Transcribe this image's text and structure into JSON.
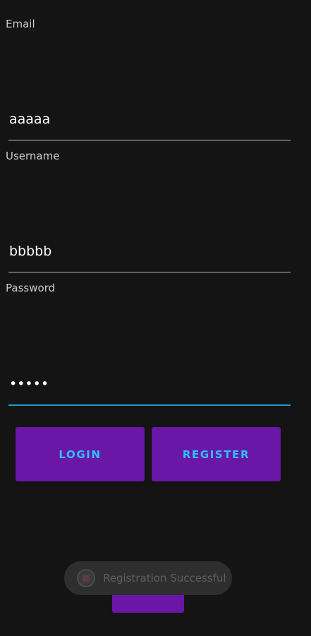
{
  "form": {
    "email": {
      "label": "Email",
      "value": "aaaaa"
    },
    "username": {
      "label": "Username",
      "value": "bbbbb"
    },
    "password": {
      "label": "Password",
      "value": "•••••"
    }
  },
  "buttons": {
    "login_label": "LOGIN",
    "register_label": "REGISTER"
  },
  "toast": {
    "message": "Registration Successful",
    "icon": "app-icon"
  },
  "colors": {
    "background": "#141414",
    "button": "#6a17a8",
    "button_text": "#2ec0f4",
    "focus_underline": "#1e9bd7"
  }
}
